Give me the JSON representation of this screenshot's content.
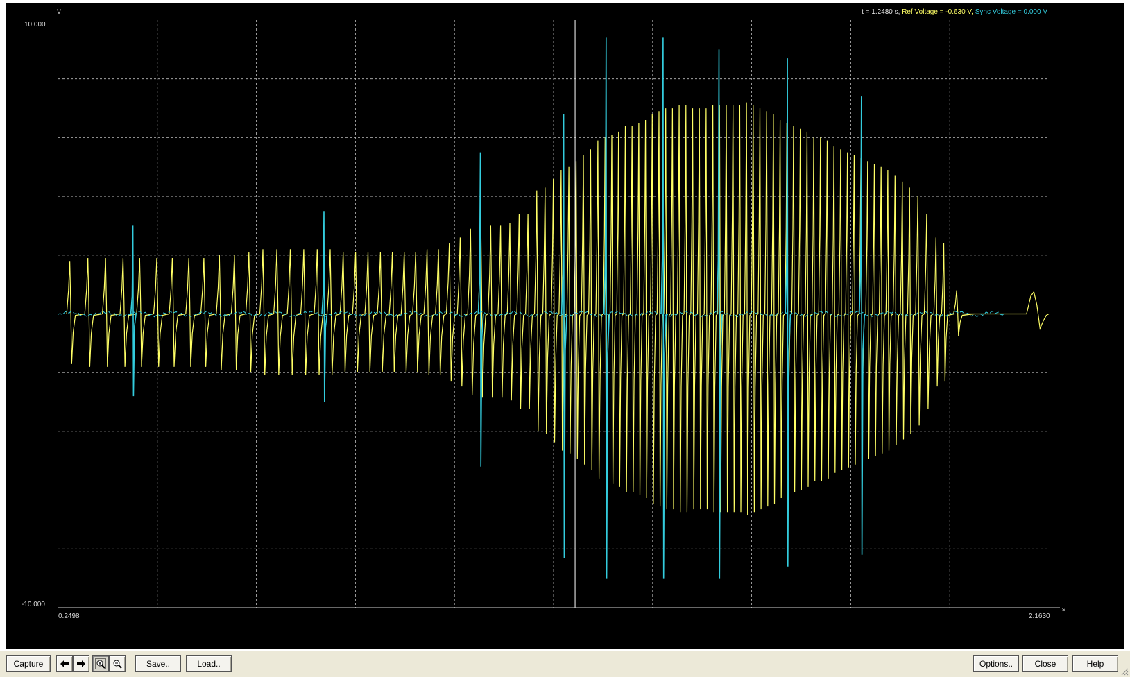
{
  "readout": {
    "time": "t = 1.2480 s,",
    "ref": " Ref Voltage = -0.630 V,",
    "sync": " Sync Voltage = 0.000 V"
  },
  "axes": {
    "y_unit": "V",
    "x_unit": "s",
    "y_max_label": "10.000",
    "y_min_label": "-10.000",
    "x_min_label": "0.2498",
    "x_max_label": "2.1630"
  },
  "chart_data": {
    "type": "line",
    "x_range": [
      0.2498,
      2.163
    ],
    "y_range": [
      -10,
      10
    ],
    "grid": true,
    "cursor_t": 1.248,
    "series": [
      {
        "name": "Ref Voltage",
        "color": "#ffff66"
      },
      {
        "name": "Sync Voltage",
        "color": "#33ccdd"
      }
    ],
    "ref_bursts": [
      {
        "t": 0.272,
        "amp": 1.8
      },
      {
        "t": 0.307,
        "amp": 1.9
      },
      {
        "t": 0.341,
        "amp": 1.9
      },
      {
        "t": 0.375,
        "amp": 1.9
      },
      {
        "t": 0.407,
        "amp": 1.9
      },
      {
        "t": 0.44,
        "amp": 1.9
      },
      {
        "t": 0.47,
        "amp": 1.9
      },
      {
        "t": 0.502,
        "amp": 1.9
      },
      {
        "t": 0.531,
        "amp": 1.9
      },
      {
        "t": 0.561,
        "amp": 2.0
      },
      {
        "t": 0.59,
        "amp": 2.0
      },
      {
        "t": 0.618,
        "amp": 2.1
      },
      {
        "t": 0.645,
        "amp": 2.2
      },
      {
        "t": 0.672,
        "amp": 2.2
      },
      {
        "t": 0.698,
        "amp": 2.2
      },
      {
        "t": 0.724,
        "amp": 2.2
      },
      {
        "t": 0.75,
        "amp": 2.2
      },
      {
        "t": 0.775,
        "amp": 2.2
      },
      {
        "t": 0.8,
        "amp": 2.1
      },
      {
        "t": 0.824,
        "amp": 2.1
      },
      {
        "t": 0.848,
        "amp": 2.1
      },
      {
        "t": 0.872,
        "amp": 2.1
      },
      {
        "t": 0.895,
        "amp": 2.1
      },
      {
        "t": 0.918,
        "amp": 2.1
      },
      {
        "t": 0.94,
        "amp": 2.1
      },
      {
        "t": 0.962,
        "amp": 2.2
      },
      {
        "t": 0.984,
        "amp": 2.2
      },
      {
        "t": 1.005,
        "amp": 2.4
      },
      {
        "t": 1.026,
        "amp": 2.6
      },
      {
        "t": 1.046,
        "amp": 2.9
      },
      {
        "t": 1.066,
        "amp": 3.0
      },
      {
        "t": 1.085,
        "amp": 3.0
      },
      {
        "t": 1.104,
        "amp": 3.0
      },
      {
        "t": 1.122,
        "amp": 3.1
      },
      {
        "t": 1.14,
        "amp": 3.4
      },
      {
        "t": 1.157,
        "amp": 3.4
      },
      {
        "t": 1.174,
        "amp": 4.2
      },
      {
        "t": 1.19,
        "amp": 4.3
      },
      {
        "t": 1.206,
        "amp": 4.6
      },
      {
        "t": 1.221,
        "amp": 4.9
      },
      {
        "t": 1.236,
        "amp": 5.0
      },
      {
        "t": 1.25,
        "amp": 5.2
      },
      {
        "t": 1.264,
        "amp": 5.4
      },
      {
        "t": 1.278,
        "amp": 5.6
      },
      {
        "t": 1.292,
        "amp": 5.9
      },
      {
        "t": 1.306,
        "amp": 6.0
      },
      {
        "t": 1.319,
        "amp": 6.1
      },
      {
        "t": 1.332,
        "amp": 6.2
      },
      {
        "t": 1.345,
        "amp": 6.4
      },
      {
        "t": 1.358,
        "amp": 6.4
      },
      {
        "t": 1.371,
        "amp": 6.5
      },
      {
        "t": 1.384,
        "amp": 6.6
      },
      {
        "t": 1.397,
        "amp": 6.8
      },
      {
        "t": 1.41,
        "amp": 6.9
      },
      {
        "t": 1.423,
        "amp": 7.0
      },
      {
        "t": 1.436,
        "amp": 7.0
      },
      {
        "t": 1.449,
        "amp": 7.1
      },
      {
        "t": 1.462,
        "amp": 7.1
      },
      {
        "t": 1.475,
        "amp": 7.0
      },
      {
        "t": 1.488,
        "amp": 7.0
      },
      {
        "t": 1.501,
        "amp": 7.0
      },
      {
        "t": 1.514,
        "amp": 7.1
      },
      {
        "t": 1.527,
        "amp": 7.1
      },
      {
        "t": 1.54,
        "amp": 7.1
      },
      {
        "t": 1.553,
        "amp": 7.1
      },
      {
        "t": 1.566,
        "amp": 7.1
      },
      {
        "t": 1.579,
        "amp": 7.2
      },
      {
        "t": 1.592,
        "amp": 7.1
      },
      {
        "t": 1.605,
        "amp": 7.0
      },
      {
        "t": 1.618,
        "amp": 6.9
      },
      {
        "t": 1.631,
        "amp": 6.8
      },
      {
        "t": 1.644,
        "amp": 6.6
      },
      {
        "t": 1.657,
        "amp": 6.5
      },
      {
        "t": 1.67,
        "amp": 6.4
      },
      {
        "t": 1.683,
        "amp": 6.3
      },
      {
        "t": 1.696,
        "amp": 6.2
      },
      {
        "t": 1.709,
        "amp": 6.0
      },
      {
        "t": 1.722,
        "amp": 6.0
      },
      {
        "t": 1.735,
        "amp": 5.9
      },
      {
        "t": 1.748,
        "amp": 5.7
      },
      {
        "t": 1.761,
        "amp": 5.6
      },
      {
        "t": 1.774,
        "amp": 5.5
      },
      {
        "t": 1.787,
        "amp": 5.4
      },
      {
        "t": 1.8,
        "amp": 5.3
      },
      {
        "t": 1.813,
        "amp": 5.2
      },
      {
        "t": 1.826,
        "amp": 5.1
      },
      {
        "t": 1.839,
        "amp": 5.0
      },
      {
        "t": 1.852,
        "amp": 4.9
      },
      {
        "t": 1.866,
        "amp": 4.7
      },
      {
        "t": 1.88,
        "amp": 4.5
      },
      {
        "t": 1.894,
        "amp": 4.3
      },
      {
        "t": 1.91,
        "amp": 4.0
      },
      {
        "t": 1.927,
        "amp": 3.4
      },
      {
        "t": 1.945,
        "amp": 2.6
      },
      {
        "t": 1.96,
        "amp": 2.4
      },
      {
        "t": 1.985,
        "amp": 0.8
      }
    ],
    "sync_spikes": [
      {
        "t": 0.394,
        "up": 3.0,
        "down": 2.8
      },
      {
        "t": 0.763,
        "up": 3.5,
        "down": 3.0
      },
      {
        "t": 1.065,
        "up": 5.5,
        "down": 5.2
      },
      {
        "t": 1.226,
        "up": 6.8,
        "down": 8.3
      },
      {
        "t": 1.308,
        "up": 9.4,
        "down": 9.0
      },
      {
        "t": 1.418,
        "up": 9.4,
        "down": 9.0
      },
      {
        "t": 1.526,
        "up": 9.0,
        "down": 9.0
      },
      {
        "t": 1.658,
        "up": 8.7,
        "down": 8.6
      },
      {
        "t": 1.801,
        "up": 7.4,
        "down": 8.2
      }
    ]
  },
  "toolbar": {
    "capture_label": "Capture",
    "save_label": "Save..",
    "load_label": "Load..",
    "options_label": "Options..",
    "close_label": "Close",
    "help_label": "Help"
  },
  "icons": {
    "prev": "arrow-left-icon",
    "next": "arrow-right-icon",
    "zoom_in": "zoom-in-icon",
    "zoom_out": "zoom-out-icon"
  }
}
